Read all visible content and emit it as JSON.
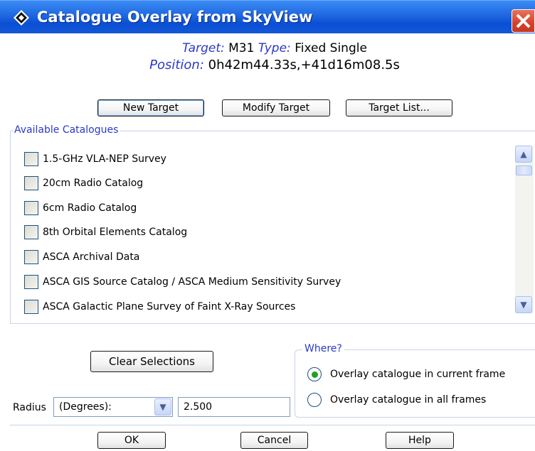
{
  "window": {
    "title": "Catalogue Overlay from SkyView",
    "close_glyph": "✕"
  },
  "target_info": {
    "target_label": "Target:",
    "target_value": "M31",
    "type_label": "Type:",
    "type_value": "Fixed Single",
    "position_label": "Position:",
    "position_value": "0h42m44.33s,+41d16m08.5s"
  },
  "target_buttons": {
    "new_target": "New Target",
    "modify_target": "Modify Target",
    "target_list": "Target List..."
  },
  "catalogues": {
    "legend": "Available Catalogues",
    "items": [
      {
        "label": "1.5-GHz VLA-NEP Survey",
        "checked": false
      },
      {
        "label": "20cm Radio Catalog",
        "checked": false
      },
      {
        "label": "6cm Radio Catalog",
        "checked": false
      },
      {
        "label": "8th Orbital Elements Catalog",
        "checked": false
      },
      {
        "label": "ASCA Archival Data",
        "checked": false
      },
      {
        "label": "ASCA GIS Source Catalog / ASCA Medium Sensitivity Survey",
        "checked": false
      },
      {
        "label": "ASCA Galactic Plane Survey of Faint X-Ray Sources",
        "checked": false
      }
    ],
    "scroll_up_glyph": "▲",
    "scroll_down_glyph": "▼"
  },
  "clear_selections": "Clear Selections",
  "where": {
    "legend": "Where?",
    "options": [
      {
        "label": "Overlay catalogue in current frame",
        "selected": true
      },
      {
        "label": "Overlay catalogue in all frames",
        "selected": false
      }
    ]
  },
  "radius": {
    "label": "Radius",
    "unit_selected": "(Degrees):",
    "dropdown_glyph": "▼",
    "value": "2.500"
  },
  "footer": {
    "ok": "OK",
    "cancel": "Cancel",
    "help": "Help"
  },
  "colors": {
    "titlebar": "#1f67e0",
    "label_blue": "#2a39c8",
    "close_red": "#d6412b",
    "radio_green": "#21a121"
  },
  "icons": {
    "app": "skyview-diamond-icon",
    "close": "close-icon",
    "scroll_up": "chevron-up-icon",
    "scroll_down": "chevron-down-icon",
    "dropdown": "chevron-down-icon"
  }
}
